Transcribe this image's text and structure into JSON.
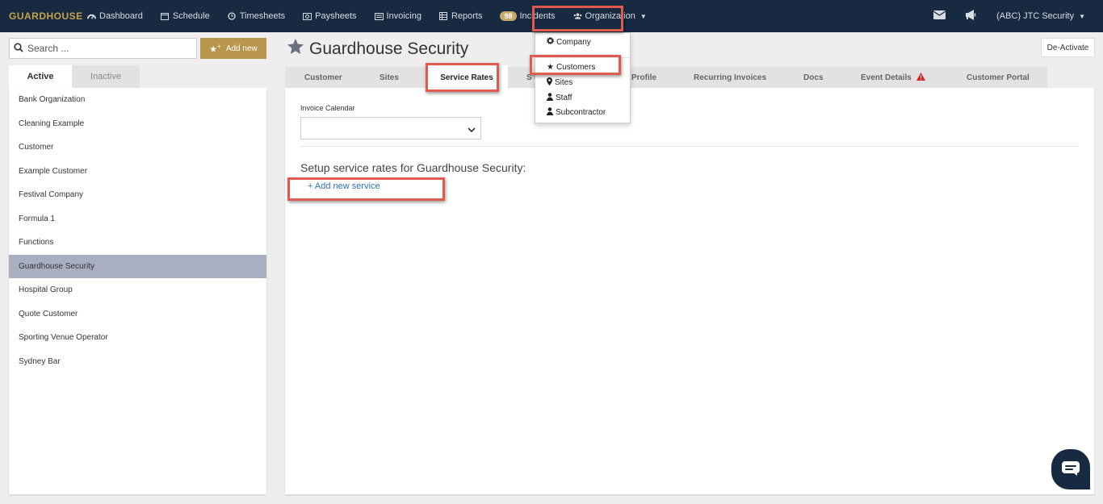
{
  "brand": "GUARDHOUSE",
  "nav": {
    "dashboard": "Dashboard",
    "schedule": "Schedule",
    "timesheets": "Timesheets",
    "paysheets": "Paysheets",
    "invoicing": "Invoicing",
    "reports": "Reports",
    "incidents_count": "98",
    "incidents": "Incidents",
    "organization": "Organization",
    "account": "(ABC) JTC Security"
  },
  "org_menu": {
    "company": "Company",
    "customers": "Customers",
    "sites": "Sites",
    "staff": "Staff",
    "subcontractor": "Subcontractor"
  },
  "sidebar": {
    "search_placeholder": "Search ...",
    "add_new": "Add new",
    "tab_active": "Active",
    "tab_inactive": "Inactive",
    "items": [
      "Bank Organization",
      "Cleaning Example",
      "Customer",
      "Example Customer",
      "Festival Company",
      "Formula 1",
      "Functions",
      "Guardhouse Security",
      "Hospital Group",
      "Quote Customer",
      "Sporting Venue Operator",
      "Sydney Bar"
    ],
    "selected": "Guardhouse Security"
  },
  "main": {
    "title": "Guardhouse Security",
    "deactivate": "De-Activate",
    "tabs": {
      "customer": "Customer",
      "sites": "Sites",
      "service_rates": "Service Rates",
      "hidden_tab": "S",
      "profile": "Profile",
      "recurring": "Recurring Invoices",
      "docs": "Docs",
      "event_details": "Event Details",
      "portal": "Customer Portal"
    },
    "invoice_calendar_label": "Invoice Calendar",
    "invoice_calendar_value": "",
    "setup_text": "Setup service rates for Guardhouse Security:",
    "add_service": "+ Add new service"
  },
  "colors": {
    "nav_bg": "#172a41",
    "brand_gold": "#c8a24a",
    "add_button": "#b8964b",
    "selected_row": "#a9afc1",
    "highlight": "#e05a4e",
    "link": "#2a72b5"
  }
}
